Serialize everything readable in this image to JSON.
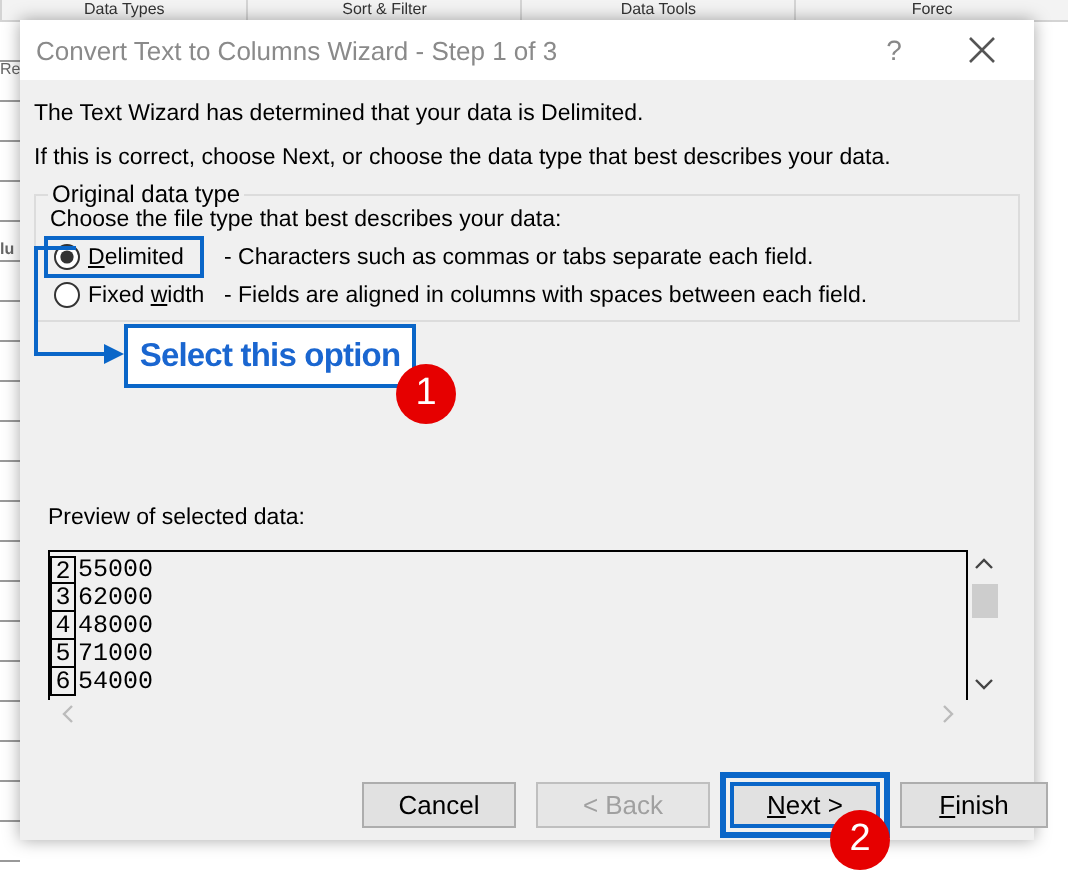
{
  "background": {
    "ribbon_groups": [
      "Data Types",
      "Sort & Filter",
      "Data Tools",
      "Forec"
    ],
    "fragments": [
      "Re",
      "lu"
    ]
  },
  "dialog": {
    "title": "Convert Text to Columns Wizard - Step 1 of 3",
    "help": "?"
  },
  "intro": [
    "The Text Wizard has determined that your data is Delimited.",
    "If this is correct, choose Next, or choose the data type that best describes your data."
  ],
  "data_type": {
    "title": "Original data type",
    "prompt": "Choose the file type that best describes your data:",
    "options": [
      {
        "label_parts": [
          {
            "text": "D",
            "underlined": true
          },
          {
            "text": "elimited",
            "underlined": false
          }
        ],
        "description": "- Characters such as commas or tabs separate each field.",
        "selected": true,
        "highlighted": true
      },
      {
        "label_parts": [
          {
            "text": "Fixed ",
            "underlined": false
          },
          {
            "text": "w",
            "underlined": true
          },
          {
            "text": "idth",
            "underlined": false
          }
        ],
        "description": "- Fields are aligned in columns with spaces between each field.",
        "selected": false,
        "highlighted": false
      }
    ]
  },
  "callout": {
    "text": "Select this option",
    "badge": "1"
  },
  "preview": {
    "label": "Preview of selected data:",
    "rows": [
      {
        "line": "2",
        "value": "55000"
      },
      {
        "line": "3",
        "value": "62000"
      },
      {
        "line": "4",
        "value": "48000"
      },
      {
        "line": "5",
        "value": "71000"
      },
      {
        "line": "6",
        "value": "54000"
      }
    ]
  },
  "buttons": [
    {
      "label_parts": [
        {
          "text": "Cancel",
          "underlined": false
        }
      ],
      "disabled": false,
      "highlighted": false
    },
    {
      "label_parts": [
        {
          "text": "< Back",
          "underlined": false
        }
      ],
      "disabled": true,
      "highlighted": false
    },
    {
      "label_parts": [
        {
          "text": "N",
          "underlined": true
        },
        {
          "text": "ext >",
          "underlined": false
        }
      ],
      "disabled": false,
      "highlighted": true,
      "badge": "2"
    },
    {
      "label_parts": [
        {
          "text": "F",
          "underlined": true
        },
        {
          "text": "inish",
          "underlined": false
        }
      ],
      "disabled": false,
      "highlighted": false
    }
  ]
}
